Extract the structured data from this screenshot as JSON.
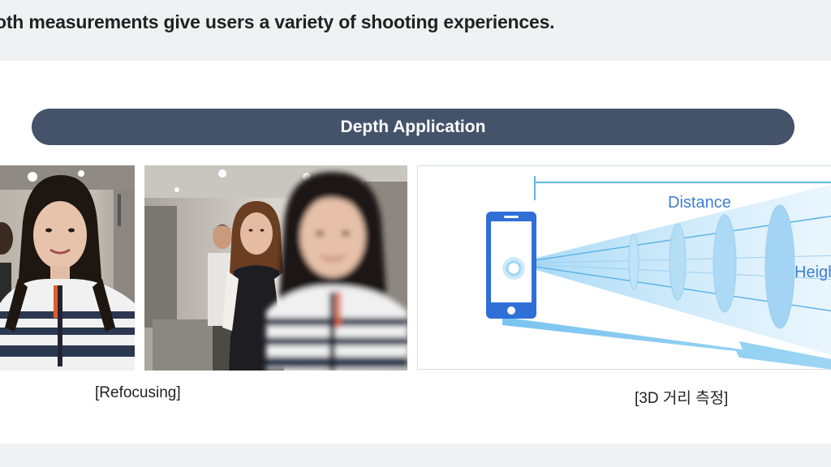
{
  "header": {
    "text": "oth measurements give users a variety of shooting experiences."
  },
  "banner": {
    "title": "Depth Application"
  },
  "captions": {
    "left": "[Refocusing]",
    "right": "[3D 거리 측정]"
  },
  "diagram": {
    "distance_label": "Distance",
    "height_label": "Heigh"
  },
  "colors": {
    "banner": "#44536a",
    "page_background": "#f0f1f2",
    "diagram_blue": "#2f6fd6",
    "diagram_light_blue": "#7fc4ee"
  }
}
